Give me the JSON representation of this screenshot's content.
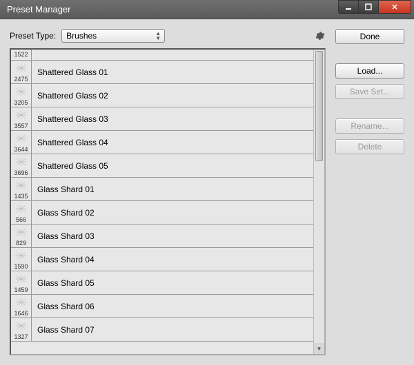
{
  "window": {
    "title": "Preset Manager"
  },
  "topRow": {
    "label": "Preset Type:",
    "dropdownValue": "Brushes"
  },
  "buttons": {
    "done": "Done",
    "load": "Load...",
    "saveSet": "Save Set...",
    "rename": "Rename...",
    "delete": "Delete"
  },
  "firstRow": {
    "size": "1522"
  },
  "brushes": [
    {
      "size": "2475",
      "name": "Shattered Glass 01"
    },
    {
      "size": "3205",
      "name": "Shattered Glass 02"
    },
    {
      "size": "3557",
      "name": "Shattered Glass 03"
    },
    {
      "size": "3644",
      "name": "Shattered Glass 04"
    },
    {
      "size": "3696",
      "name": "Shattered Glass 05"
    },
    {
      "size": "1435",
      "name": "Glass Shard 01"
    },
    {
      "size": "566",
      "name": "Glass Shard 02"
    },
    {
      "size": "829",
      "name": "Glass Shard 03"
    },
    {
      "size": "1590",
      "name": "Glass Shard 04"
    },
    {
      "size": "1459",
      "name": "Glass Shard 05"
    },
    {
      "size": "1646",
      "name": "Glass Shard 06"
    },
    {
      "size": "1327",
      "name": "Glass Shard 07"
    }
  ]
}
